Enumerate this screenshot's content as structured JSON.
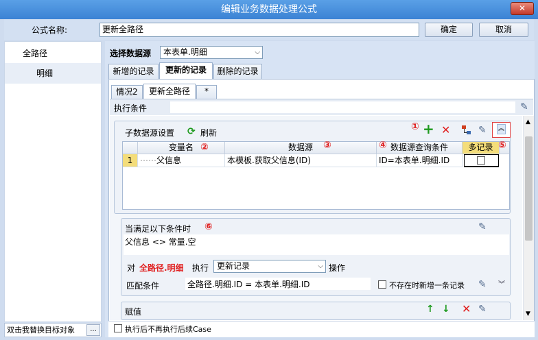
{
  "window": {
    "title": "编辑业务数据处理公式",
    "close_label": "✕"
  },
  "formula": {
    "label": "公式名称:",
    "value": "更新全路径",
    "ok_label": "确定",
    "cancel_label": "取消"
  },
  "left_panel": {
    "items": [
      {
        "label": "全路径"
      },
      {
        "label": "明细"
      }
    ],
    "bottom_text": "双击我替换目标对象",
    "bottom_btn": "..."
  },
  "datasource": {
    "label": "选择数据源",
    "value": "本表单.明细"
  },
  "record_tabs": [
    {
      "label": "新增的记录"
    },
    {
      "label": "更新的记录"
    },
    {
      "label": "删除的记录"
    }
  ],
  "case_tabs": [
    {
      "label": "情况2"
    },
    {
      "label": "更新全路径"
    },
    {
      "label": "*"
    }
  ],
  "exec_condition": {
    "label": "执行条件",
    "value": ""
  },
  "sub_ds": {
    "title": "子数据源设置",
    "refresh_label": "刷新",
    "columns": [
      "变量名",
      "数据源",
      "数据源查询条件",
      "多记录"
    ],
    "rows": [
      {
        "num": "1",
        "var": "父信息",
        "source": "本模板.获取父信息(ID)",
        "cond": "ID=本表单.明细.ID",
        "multi": false
      }
    ]
  },
  "markers": [
    "①",
    "②",
    "③",
    "④",
    "⑤",
    "⑥"
  ],
  "condition_section": {
    "title": "当满足以下条件时",
    "expr": "父信息 <> 常量.空",
    "action_prefix": "对",
    "target": "全路径.明细",
    "action_verb": "执行",
    "action_select": "更新记录",
    "action_suffix": "操作",
    "match_label": "匹配条件",
    "match_value": "全路径.明细.ID = 本表单.明细.ID",
    "insert_label": "不存在时新增一条记录"
  },
  "assign": {
    "title": "赋值"
  },
  "bottom_option": {
    "label": "执行后不再执行后续Case"
  },
  "colors": {
    "title_bar": "#3b82d4",
    "accent_red": "#e02020",
    "add_green": "#1e9a1e"
  }
}
